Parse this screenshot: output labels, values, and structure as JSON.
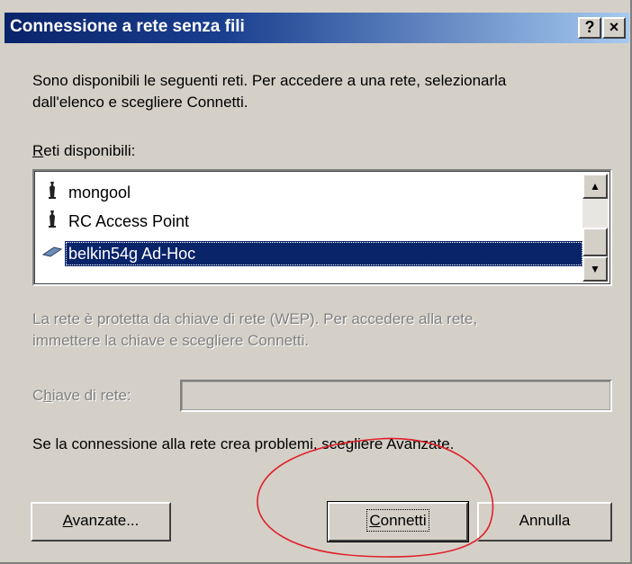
{
  "window": {
    "title": "Connessione a rete senza fili",
    "help_label": "?",
    "close_label": "×"
  },
  "intro": {
    "line1": "Sono disponibili le seguenti reti. Per accedere a una rete, selezionarla",
    "line2": "dall'elenco e scegliere Connetti."
  },
  "networks": {
    "label_accel": "R",
    "label_rest": "eti disponibili:",
    "items": [
      {
        "name": "mongool",
        "icon": "access-point-icon",
        "selected": false
      },
      {
        "name": "RC Access Point",
        "icon": "access-point-icon",
        "selected": false
      },
      {
        "name": "belkin54g Ad-Hoc",
        "icon": "adhoc-network-icon",
        "selected": true
      }
    ]
  },
  "wep": {
    "line1": "La rete è protetta da chiave di rete (WEP). Per accedere alla rete,",
    "line2": "immettere la chiave e scegliere Connetti."
  },
  "key": {
    "label_pre": "C",
    "label_accel": "h",
    "label_rest": "iave di rete:",
    "value": ""
  },
  "problems_text": "Se la connessione alla rete crea problemi, scegliere Avanzate.",
  "buttons": {
    "advanced_accel": "A",
    "advanced_rest": "vanzate...",
    "connect_accel": "C",
    "connect_rest": "onnetti",
    "cancel": "Annulla"
  },
  "colors": {
    "title_bar": "#0a246a",
    "selection": "#0a246a",
    "annotation_circle": "#e0202a"
  }
}
